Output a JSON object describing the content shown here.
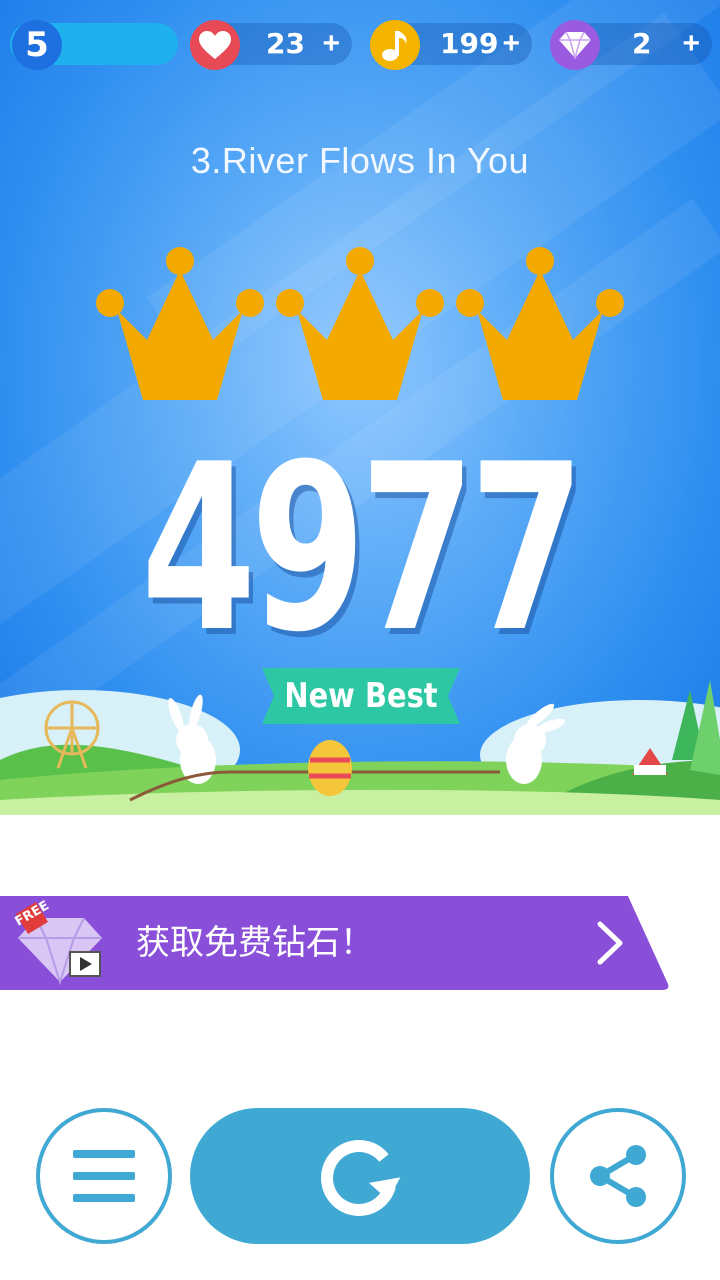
{
  "status_bar": {
    "level": "5",
    "lives": "23",
    "notes": "199",
    "diamonds": "2",
    "plus_label": "+"
  },
  "song": {
    "title": "3.River Flows In You"
  },
  "result": {
    "crowns_earned": 3,
    "crowns_total": 3,
    "score": "4977",
    "badge": "New Best"
  },
  "promo": {
    "free_tag": "FREE",
    "text": "获取免费钻石！",
    "arrow": "chevron-right-icon"
  },
  "actions": {
    "menu_icon": "menu-icon",
    "retry_icon": "retry-icon",
    "share_icon": "share-icon"
  },
  "colors": {
    "crown": "#f3a900",
    "badge": "#2ec7a4",
    "promo": "#8a4fd8",
    "button": "#3fa9d4",
    "heart": "#e84a55",
    "note": "#f5b400",
    "diamond": "#9b5be0"
  }
}
